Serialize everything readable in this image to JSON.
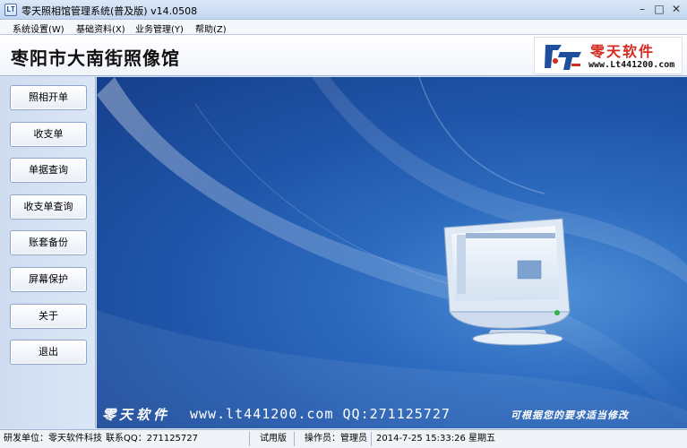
{
  "window": {
    "title": "零天照相馆管理系统(普及版)  v14.0508",
    "icon": "app-icon",
    "controls": [
      "minimize-icon",
      "maximize-icon",
      "close-icon"
    ]
  },
  "menu": {
    "items": [
      {
        "label": "系统设置(W)"
      },
      {
        "label": "基础资料(X)"
      },
      {
        "label": "业务管理(Y)"
      },
      {
        "label": "帮助(Z)"
      }
    ]
  },
  "header": {
    "shop_name": "枣阳市大南街照像馆",
    "logo": {
      "brand": "零天软件",
      "url": "www.Lt441200.com",
      "colors": {
        "red": "#d42a1f",
        "blue": "#1f4f9c"
      }
    }
  },
  "sidebar": {
    "items": [
      {
        "label": "照相开单"
      },
      {
        "label": "收支单"
      },
      {
        "label": "单据查询"
      },
      {
        "label": "收支单查询"
      },
      {
        "label": "账套备份"
      },
      {
        "label": "屏幕保护"
      },
      {
        "label": "关于"
      },
      {
        "label": "退出"
      }
    ]
  },
  "canvas": {
    "banner_brand": "零天软件",
    "banner_contact": "www.lt441200.com QQ:271125727",
    "banner_note": "可根据您的要求适当修改",
    "background": "#1f55a9"
  },
  "status": {
    "developer": "研发单位：零天软件科技",
    "qq": "联系QQ：271125727",
    "edition": "试用版",
    "operator": "操作员：管理员",
    "datetime": "2014-7-25 15:33:26 星期五"
  }
}
